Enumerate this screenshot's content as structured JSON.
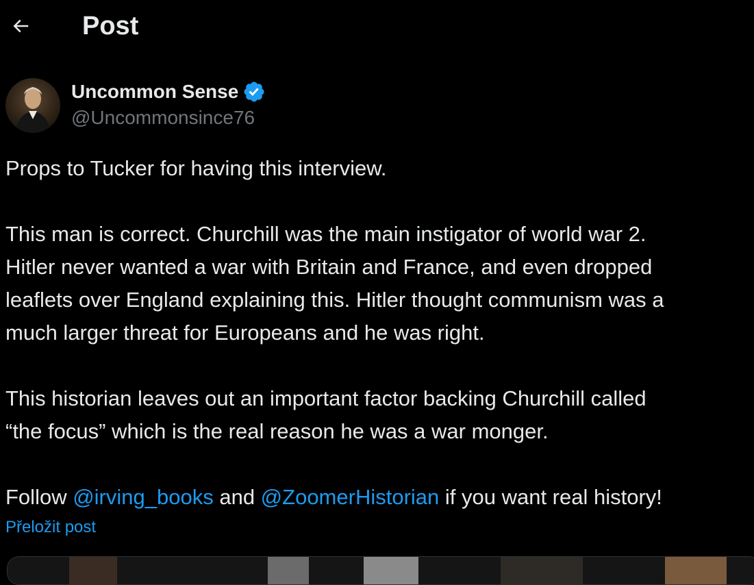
{
  "header": {
    "title": "Post",
    "back_icon": "arrow-left-icon"
  },
  "author": {
    "display_name": "Uncommon Sense",
    "handle": "@Uncommonsince76",
    "verified_icon": "verified-badge-icon",
    "verified_color": "#1d9bf0"
  },
  "tweet": {
    "p1": [
      "Props to Tucker for having this interview."
    ],
    "p2": [
      "This man is correct. Churchill was the main instigator of world war 2.",
      "Hitler never wanted a war with Britain and France, and even dropped",
      "leaflets over England explaining this. Hitler thought communism was a",
      "much larger threat for Europeans and he was right."
    ],
    "p3": [
      "This historian leaves out an important factor backing Churchill called",
      "“the focus” which is the real reason he was a war monger."
    ],
    "p4": {
      "before": "Follow ",
      "mention1": "@irving_books",
      "middle": " and ",
      "mention2": "@ZoomerHistorian",
      "after": " if you want real history!"
    },
    "translate_label": "Přeložit post"
  },
  "colors": {
    "background": "#000000",
    "text": "#e7e9ea",
    "secondary": "#71767b",
    "link": "#1d9bf0"
  }
}
